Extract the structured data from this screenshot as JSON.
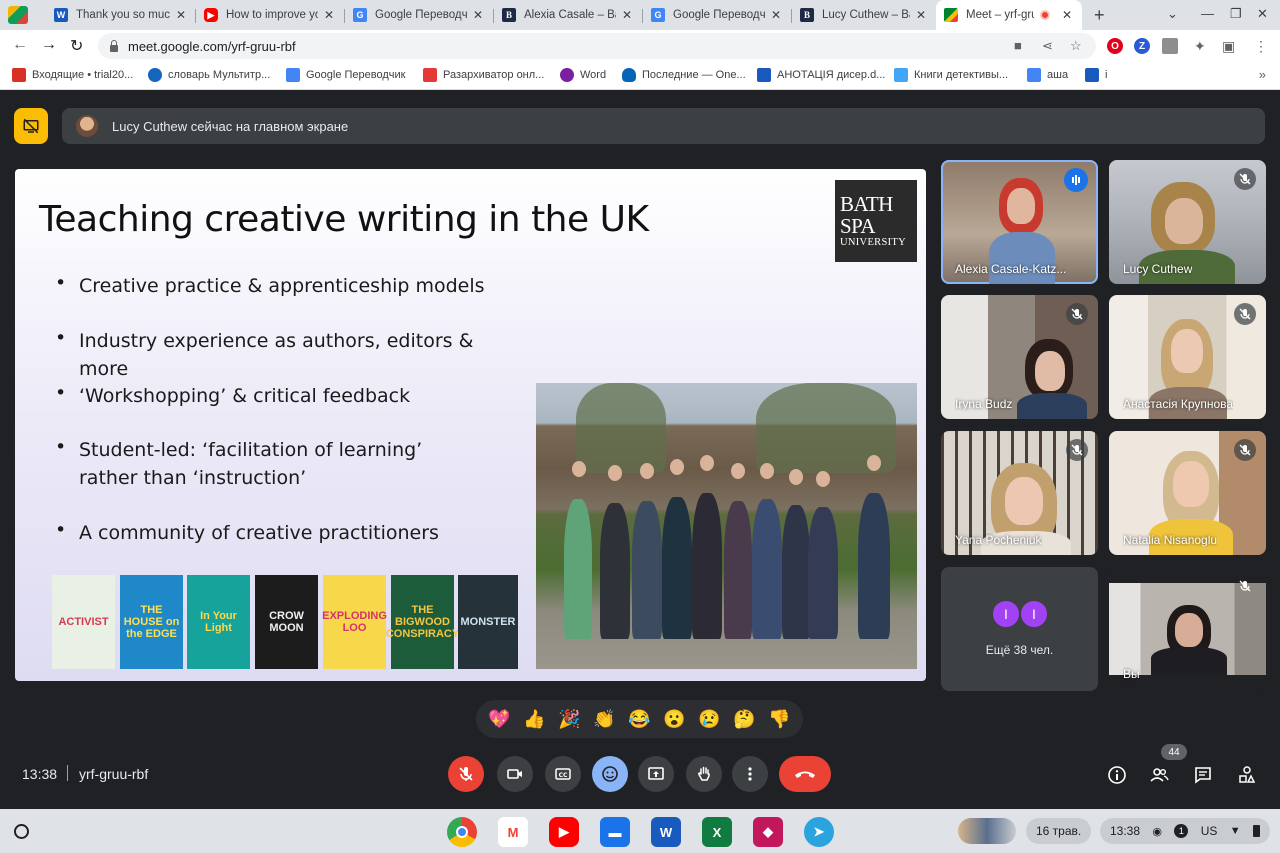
{
  "browser": {
    "tabs": [
      {
        "label": "Thank you so much",
        "icon": "word-doc-icon",
        "color": "#185abd"
      },
      {
        "label": "How to improve yo",
        "icon": "youtube-icon",
        "color": "#ff0000"
      },
      {
        "label": "Google Переводчик",
        "icon": "google-translate-icon",
        "color": "#4285f4"
      },
      {
        "label": "Alexia Casale – Ba",
        "icon": "bath-spa-icon",
        "color": "#1f2a44"
      },
      {
        "label": "Google Переводчик",
        "icon": "google-translate-icon",
        "color": "#4285f4"
      },
      {
        "label": "Lucy Cuthew – Bat",
        "icon": "bath-spa-icon",
        "color": "#1f2a44"
      },
      {
        "label": "Meet – yrf-gru",
        "icon": "google-meet-icon",
        "color": "#00897b",
        "active": true
      }
    ],
    "url": "meet.google.com/yrf-gruu-rbf",
    "bookmarks": [
      {
        "label": "Входящие • trial20...",
        "color": "#d93025"
      },
      {
        "label": "словарь Мультитр...",
        "color": "#1565c0"
      },
      {
        "label": "Google Переводчик",
        "color": "#4285f4"
      },
      {
        "label": "Разархиватор онл...",
        "color": "#e53935"
      },
      {
        "label": "Word",
        "color": "#7b1fa2"
      },
      {
        "label": "Последние — One...",
        "color": "#0364b8"
      },
      {
        "label": "АНОТАЦІЯ дисер.d...",
        "color": "#185abd"
      },
      {
        "label": "Книги детективы...",
        "color": "#42a5f5"
      },
      {
        "label": "аша",
        "color": "#4285f4"
      },
      {
        "label": "і",
        "color": "#185abd"
      }
    ],
    "bookmarks_more": "»"
  },
  "meet": {
    "banner": "Lucy Cuthew сейчас на главном экране",
    "slide": {
      "title": "Teaching creative writing in the UK",
      "logo_line1": "BATH",
      "logo_line2": "SPA",
      "logo_line3": "UNIVERSITY",
      "bullets": [
        "Creative practice & apprenticeship models",
        "Industry experience as authors, editors & more",
        "‘Workshopping’ & critical feedback",
        "Student-led: ‘facilitation of learning’ rather than ‘instruction’",
        "A community of creative practitioners"
      ],
      "books": [
        {
          "title": "ACTIVIST",
          "bg": "#e9f0e6",
          "fg": "#d63a52"
        },
        {
          "title": "THE HOUSE on the EDGE",
          "bg": "#1e88c9",
          "fg": "#ffe14d"
        },
        {
          "title": "In Your Light",
          "bg": "#15a39c",
          "fg": "#ffd94a"
        },
        {
          "title": "CROW MOON",
          "bg": "#1c1c1c",
          "fg": "#f0f0f0"
        },
        {
          "title": "EXPLODING LOO",
          "bg": "#f6d84a",
          "fg": "#d6336c"
        },
        {
          "title": "THE BIGWOOD CONSPIRACY",
          "bg": "#1d5c3a",
          "fg": "#f4c542"
        },
        {
          "title": "MONSTER",
          "bg": "#26323a",
          "fg": "#cfe3ee"
        }
      ]
    },
    "participants": [
      {
        "name": "Alexia Casale-Katz...",
        "state": "speaking"
      },
      {
        "name": "Lucy Cuthew",
        "state": "muted"
      },
      {
        "name": "Iryna Budz",
        "state": "muted"
      },
      {
        "name": "Анастасія Крупнова",
        "state": "muted"
      },
      {
        "name": "Yana Pocheniuk",
        "state": "muted"
      },
      {
        "name": "Natalia Nisanoglu",
        "state": "muted"
      },
      {
        "name": "Вы",
        "state": "muted"
      }
    ],
    "more": {
      "initials": [
        "I",
        "I"
      ],
      "label": "Ещё 38 чел."
    },
    "reactions": [
      "💖",
      "👍",
      "🎉",
      "👏",
      "😂",
      "😮",
      "😢",
      "🤔",
      "👎"
    ],
    "time": "13:38",
    "meeting_code": "yrf-gruu-rbf",
    "participant_count": "44"
  },
  "shelf": {
    "date": "16 трав.",
    "time": "13:38",
    "notifications": "1",
    "locale": "US"
  }
}
